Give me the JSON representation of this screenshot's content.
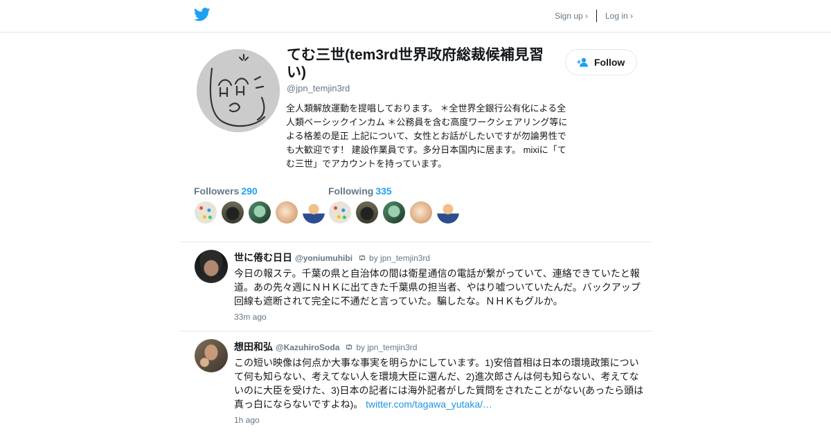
{
  "header": {
    "signup_label": "Sign up ›",
    "login_label": "Log in ›"
  },
  "profile": {
    "display_name": "てむ三世(tem3rd世界政府総裁候補見習い)",
    "handle": "@jpn_temjin3rd",
    "bio": "全人類解放運動を提唱しております。 ＊全世界全銀行公有化による全人類ベーシックインカム ＊公務員を含む高度ワークシェアリング等による格差の是正 上記について、女性とお話がしたいですが勿論男性でも大歓迎です！ 建設作業員です。多分日本国内に居ます。 mixiに「てむ三世」でアカウントを持っています。",
    "follow_label": "Follow",
    "followers_label": "Followers",
    "followers_count": "290",
    "following_label": "Following",
    "following_count": "335"
  },
  "tweets": [
    {
      "name": "世に倦む日日",
      "screen_name": "@yoniumuhibi",
      "retweeted_by": "by jpn_temjin3rd",
      "text": "今日の報ステ。千葉の県と自治体の間は衛星通信の電話が繋がっていて、連絡できていたと報道。あの先々週にＮＨＫに出てきた千葉県の担当者、やはり嘘ついていたんだ。バックアップ回線も遮断されて完全に不通だと言っていた。騙したな。ＮＨＫもグルか。",
      "link": "",
      "time": "33m ago"
    },
    {
      "name": "想田和弘",
      "screen_name": "@KazuhiroSoda",
      "retweeted_by": "by jpn_temjin3rd",
      "text": "この短い映像は何点か大事な事実を明らかにしています。1)安倍首相は日本の環境政策について何も知らない、考えてない人を環境大臣に選んだ、2)進次郎さんは何も知らない、考えてないのに大臣を受けた、3)日本の記者には海外記者がした質問をされたことがない(あったら頭は真っ白にならないですよね)。",
      "link": "twitter.com/tagawa_yutaka/…",
      "time": "1h ago"
    }
  ],
  "colors": {
    "accent": "#1da1f2",
    "link": "#1b95e0",
    "muted": "#657786",
    "text": "#14171a"
  }
}
